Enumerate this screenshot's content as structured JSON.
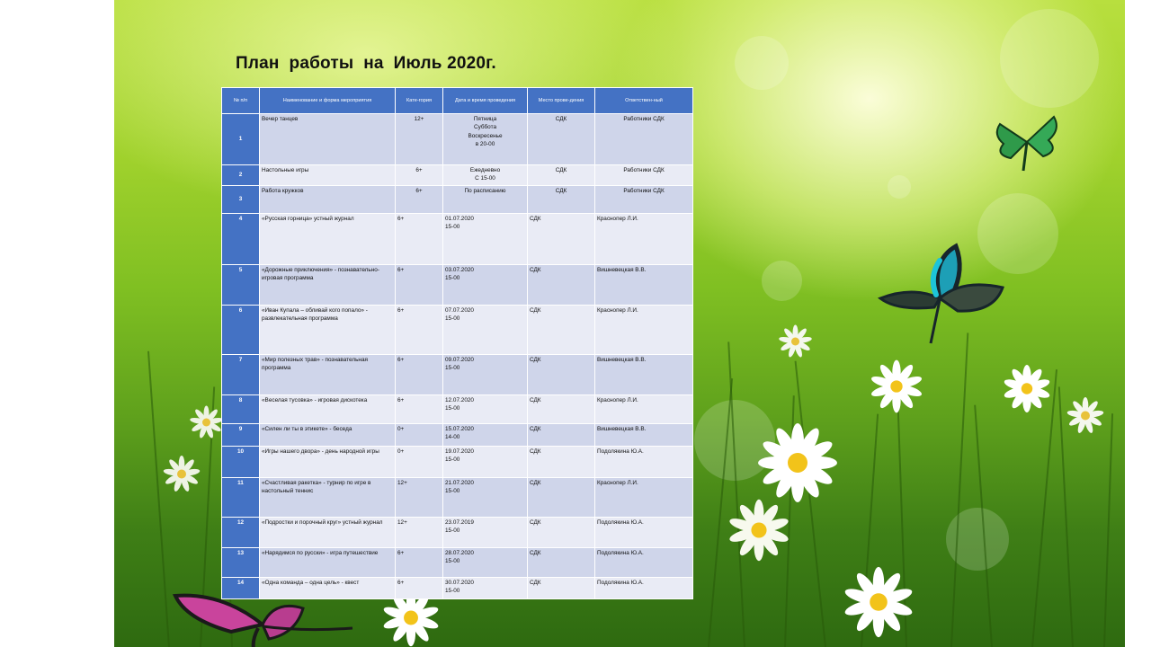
{
  "title": "План  работы  на  Июль 2020г.",
  "table": {
    "headers": [
      "№ п/п",
      "Наименование и форма мероприятия",
      "Кате-гория",
      "Дата и время проведения",
      "Место прове-дения",
      "Ответствен-ный"
    ],
    "rows": [
      {
        "num": "1",
        "name": "Вечер танцев",
        "category": "12+",
        "date": "Пятница\nСуббота\nВоскресенье\nв 20-00",
        "place": "СДК",
        "responsible": "Работники СДК"
      },
      {
        "num": "2",
        "name": "Настольные игры",
        "category": "6+",
        "date": "Ежедневно\nС 15-00",
        "place": "СДК",
        "responsible": "Работники СДК"
      },
      {
        "num": "3",
        "name": "Работа кружков",
        "category": "6+",
        "date": "По расписанию",
        "place": "СДК",
        "responsible": "Работники СДК"
      },
      {
        "num": "4",
        "name": "«Русская горница» устный журнал",
        "category": "6+",
        "date": "01.07.2020\n15-00",
        "place": "СДК",
        "responsible": "Краснопер Л.И."
      },
      {
        "num": "5",
        "name": "«Дорожные приключения» - познавательно-игровая программа",
        "category": "6+",
        "date": "03.07.2020\n15-00",
        "place": "СДК",
        "responsible": "Вишневецкая В.В."
      },
      {
        "num": "6",
        "name": "«Иван Купала – обливай кого попало» - развлекательная программа",
        "category": "6+",
        "date": "07.07.2020\n15-00",
        "place": "СДК",
        "responsible": "Краснопер Л.И."
      },
      {
        "num": "7",
        "name": "«Мир полезных трав» - познавательная программа",
        "category": "6+",
        "date": "09.07.2020\n15-00",
        "place": "СДК",
        "responsible": "Вишневецкая В.В."
      },
      {
        "num": "8",
        "name": "«Веселая тусовка» - игровая дискотека",
        "category": "6+",
        "date": "12.07.2020\n15-00",
        "place": "СДК",
        "responsible": "Краснопер Л.И."
      },
      {
        "num": "9",
        "name": "«Силен ли ты в этикете» - беседа",
        "category": "0+",
        "date": "15.07.2020\n14-00",
        "place": "СДК",
        "responsible": "Вишневецкая В.В."
      },
      {
        "num": "10",
        "name": "«Игры нашего двора» - день народной игры",
        "category": "0+",
        "date": "19.07.2020\n15-00",
        "place": "СДК",
        "responsible": "Подолякина Ю.А."
      },
      {
        "num": "11",
        "name": "«Счастливая ракетка» - турнир по игре в настольный теннис",
        "category": "12+",
        "date": "21.07.2020\n15-00",
        "place": "СДК",
        "responsible": "Краснопер Л.И."
      },
      {
        "num": "12",
        "name": "«Подростки и порочный круг» устный журнал",
        "category": "12+",
        "date": "23.07.2019\n15-00",
        "place": "СДК",
        "responsible": "Подолякина Ю.А."
      },
      {
        "num": "13",
        "name": "«Нарядимся по русски» - игра путешествие",
        "category": "6+",
        "date": "28.07.2020\n15-00",
        "place": "СДК",
        "responsible": "Подолякина Ю.А."
      },
      {
        "num": "14",
        "name": "«Одна команда – одна цель» - квест",
        "category": "6+",
        "date": "30.07.2020\n15-00",
        "place": "СДК",
        "responsible": "Подолякина Ю.А."
      }
    ]
  },
  "colors": {
    "header_blue": "#4472c4",
    "row_band_dark": "#cfd5ea",
    "row_band_light": "#e9ebf5",
    "background_green": "#8cc63f"
  },
  "decorations": [
    "green-butterfly",
    "blue-butterfly",
    "pink-butterfly",
    "daisy-flowers",
    "grass-meadow"
  ]
}
